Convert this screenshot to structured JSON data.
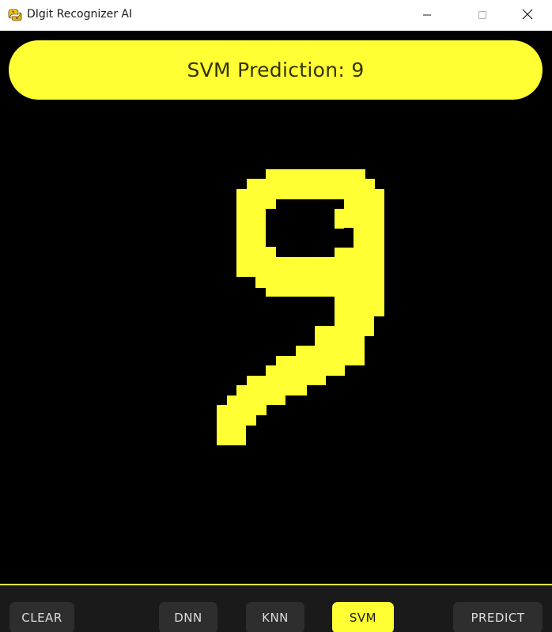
{
  "window": {
    "title": "DIgit Recognizer AI",
    "app_icon": "python-snake-icon",
    "controls": [
      "minimize-icon",
      "maximize-icon",
      "close-icon"
    ]
  },
  "prediction": {
    "text": "SVM Prediction: 9",
    "model": "SVM",
    "digit": "9"
  },
  "canvas": {
    "drawn_digit": "9",
    "stroke_color": "#ffff33",
    "background_color": "#000000"
  },
  "controls": {
    "clear_label": "CLEAR",
    "dnn_label": "DNN",
    "knn_label": "KNN",
    "svm_label": "SVM",
    "predict_label": "PREDICT",
    "selected_model": "SVM"
  },
  "colors": {
    "accent": "#ffff33",
    "button_bg": "#2e2e2e",
    "bar_bg": "#1a1a1a",
    "banner_text": "#333300"
  }
}
